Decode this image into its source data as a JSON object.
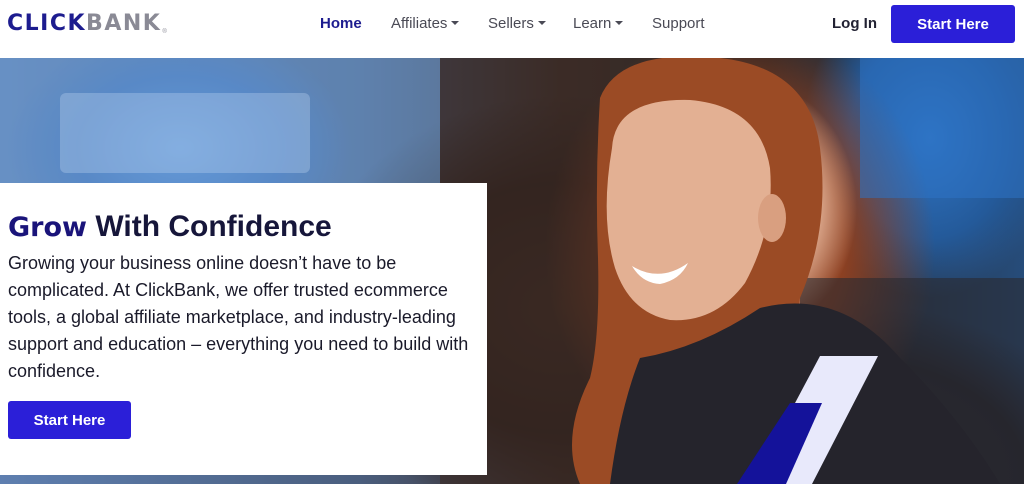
{
  "brand": {
    "name_part1": "CLICK",
    "name_part2": "BANK",
    "trademark": "®"
  },
  "nav": {
    "items": [
      {
        "label": "Home",
        "active": true,
        "dropdown": false
      },
      {
        "label": "Affiliates",
        "active": false,
        "dropdown": true
      },
      {
        "label": "Sellers",
        "active": false,
        "dropdown": true
      },
      {
        "label": "Learn",
        "active": false,
        "dropdown": true
      },
      {
        "label": "Support",
        "active": false,
        "dropdown": false
      }
    ],
    "login_label": "Log In",
    "cta_label": "Start Here"
  },
  "hero": {
    "title_strong": "Grow",
    "title_rest": " With Confidence",
    "body": "Growing your business online doesn’t have to be complicated. At ClickBank, we offer trusted ecommerce tools, a global affiliate marketplace, and industry-leading support and education – everything you need to build with confidence.",
    "cta_label": "Start Here"
  },
  "colors": {
    "brand_navy": "#1d1c8f",
    "cta_blue": "#2b1fd8",
    "stripe_light": "#e8e9fb",
    "stripe_dark": "#14129a"
  }
}
